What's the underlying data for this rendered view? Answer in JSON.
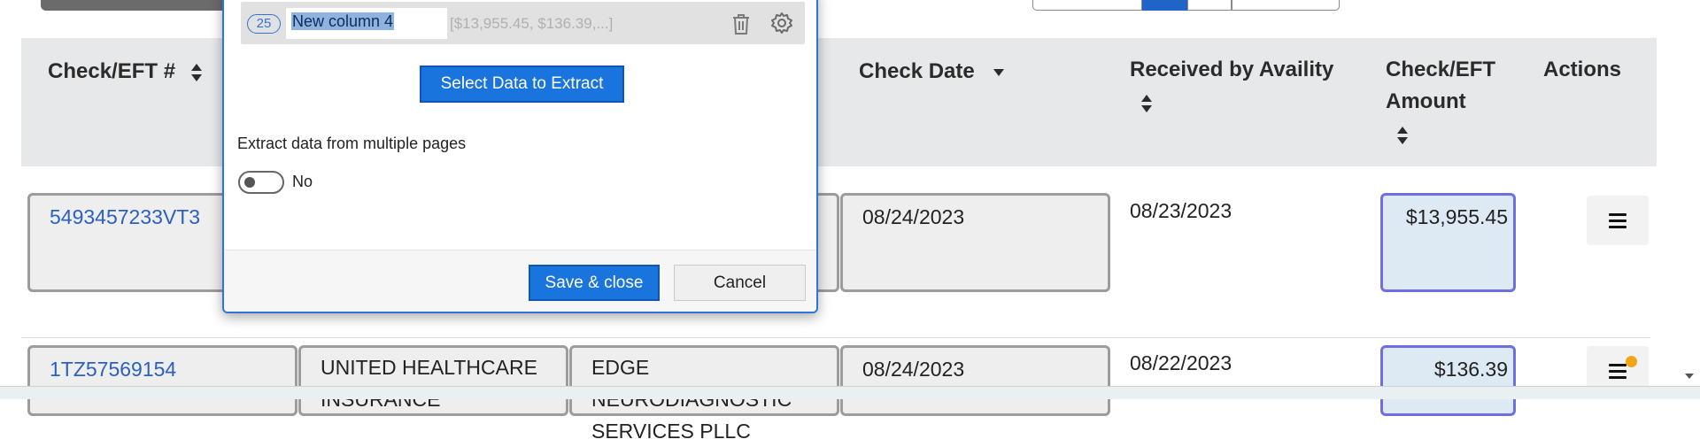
{
  "table": {
    "headers": [
      {
        "label": "Check/EFT #"
      },
      {
        "label": "Check Date"
      },
      {
        "label": "Received by Availity"
      },
      {
        "label": "Check/EFT Amount"
      },
      {
        "label": "Actions"
      }
    ],
    "rows": [
      {
        "check_number": "5493457233VT3",
        "payer": "",
        "payee": "",
        "check_date": "08/24/2023",
        "received": "08/23/2023",
        "amount": "$13,955.45"
      },
      {
        "check_number": "1TZ57569154",
        "payer": "UNITED HEALTHCARE INSURANCE",
        "payee": "EDGE NEURODIAGNOSTIC SERVICES PLLC",
        "check_date": "08/24/2023",
        "received": "08/22/2023",
        "amount": "$136.39"
      }
    ]
  },
  "dialog": {
    "column": {
      "index": "25",
      "name": "New column 4",
      "preview": "[$13,955.45, $136.39,...]"
    },
    "select_button": "Select Data to Extract",
    "multi_page_label": "Extract data from multiple pages",
    "toggle_value": "No",
    "save_button": "Save & close",
    "cancel_button": "Cancel"
  },
  "colors": {
    "accent": "#1a74de",
    "link": "#2a5fc4",
    "header_bg": "#e6e8ea",
    "amount_bg": "#deeaf3",
    "badge_dot": "#f5a316"
  }
}
